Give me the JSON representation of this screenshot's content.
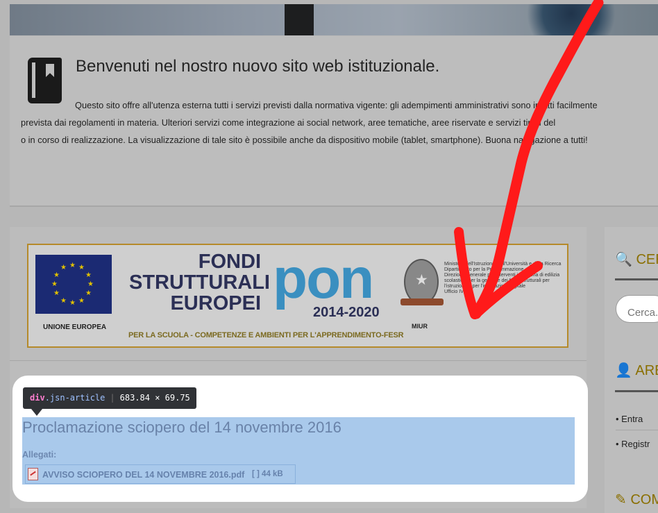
{
  "welcome": {
    "title": "Benvenuti nel nostro nuovo sito web istituzionale.",
    "text": "Questo sito offre all'utenza esterna tutti i servizi previsti dalla normativa vigente: gli adempimenti amministrativi sono infatti facilmente\n              prevista dai regolamenti in materia. Ulteriori servizi come integrazione ai social network, aree tematiche, aree riservate e servizi tipici del\no in corso di realizzazione. La visualizzazione di tale sito è possibile anche da dispositivo mobile (tablet, smartphone). Buona navigazione a tutti!"
  },
  "pon_banner": {
    "eu_label": "UNIONE EUROPEA",
    "fondi_text": "FONDI\nSTRUTTURALI\nEUROPEI",
    "pon_word": "pon",
    "pon_years": "2014-2020",
    "bottom_text": "PER LA SCUOLA - COMPETENZE E AMBIENTI PER L'APPRENDIMENTO-FESR",
    "miur_label": "MIUR",
    "miur_text": "Ministero dell'Istruzione, dell'Università e della Ricerca\nDipartimento per la Programmazione\nDirezione Generale per interventi in materia di edilizia\nscolastica, per la gestione dei fondi strutturali per\nl'istruzione e per l'innovazione digitale\nUfficio IV"
  },
  "article": {
    "title": "Proclamazione sciopero del 14 novembre 2016",
    "attachments_label": "Allegati:",
    "file_name": "AVVISO SCIOPERO DEL 14 NOVEMBRE 2016.pdf",
    "file_meta": "[ ]  44 kB"
  },
  "devtools": {
    "tag": "div",
    "class_name": ".jsn-article",
    "dimensions": "683.84 × 69.75"
  },
  "sidebar": {
    "search_heading": "CER",
    "search_placeholder": "Cerca...",
    "area_heading": "ARE",
    "links": [
      "Entra",
      "Registr"
    ],
    "com_heading": "COM"
  },
  "colors": {
    "overlay_red": "#ff1a1a",
    "highlight_blue": "#a9c9eb",
    "heading_gold": "#8a6f00"
  },
  "icons": {
    "book": "book-icon",
    "search": "search-icon",
    "user": "user-icon",
    "pencil": "pencil-icon",
    "pdf": "pdf-file-icon",
    "arrow": "red-annotation-arrow"
  }
}
